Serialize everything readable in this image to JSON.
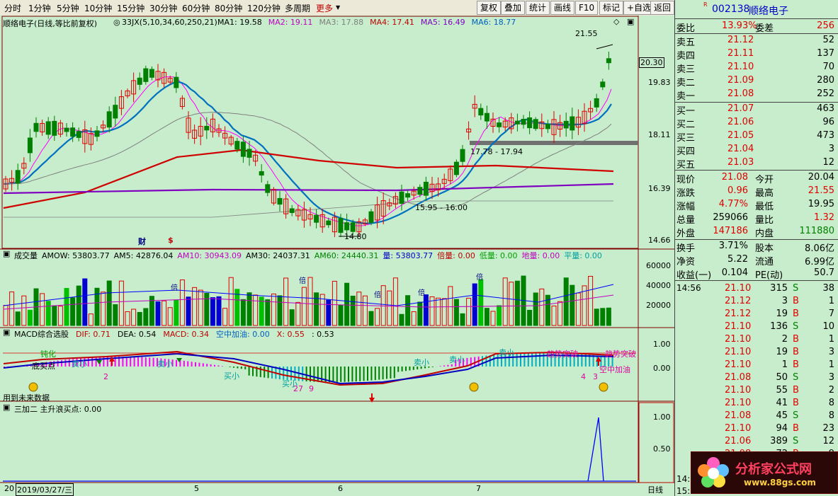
{
  "toolbar": {
    "periods": [
      "分时",
      "1分钟",
      "5分钟",
      "10分钟",
      "15分钟",
      "30分钟",
      "60分钟",
      "80分钟",
      "120分钟",
      "多周期"
    ],
    "more": "更多",
    "buttons": [
      "复权",
      "叠加",
      "统计",
      "画线",
      "F10",
      "标记",
      "+自选",
      "返回"
    ]
  },
  "price_panel": {
    "title": "顺络电子(日线,等比前复权)",
    "indicator": "33JX(5,10,34,60,250,21)",
    "ma": [
      {
        "label": "MA1: 19.58",
        "color": "#000000"
      },
      {
        "label": "MA2: 19.11",
        "color": "#c000c0"
      },
      {
        "label": "MA3: 17.88",
        "color": "#808080"
      },
      {
        "label": "MA4: 17.41",
        "color": "#c00000"
      },
      {
        "label": "MA5: 16.49",
        "color": "#8000c0"
      },
      {
        "label": "MA6: 18.77",
        "color": "#0060c0"
      }
    ],
    "y_ticks": [
      "20.30",
      "19.83",
      "18.11",
      "16.39",
      "14.66"
    ],
    "annotations": {
      "high": "21.55",
      "low": "14.80",
      "zone1": "17.78 - 17.94",
      "zone2": "15.95 - 16.00"
    },
    "markers": [
      "财",
      "$"
    ]
  },
  "volume_panel": {
    "labels": [
      {
        "text": "成交量",
        "color": "#000000"
      },
      {
        "text": "AMOW: 53803.77",
        "color": "#000000"
      },
      {
        "text": "AM5: 42876.04",
        "color": "#000000"
      },
      {
        "text": "AM10: 30943.09",
        "color": "#c000c0"
      },
      {
        "text": "AM30: 24037.31",
        "color": "#000000"
      },
      {
        "text": "AM60: 24440.31",
        "color": "#008000"
      },
      {
        "text": "量: 53803.77",
        "color": "#0000c0"
      },
      {
        "text": "倍量: 0.00",
        "color": "#c00000"
      },
      {
        "text": "低量: 0.00",
        "color": "#00a000"
      },
      {
        "text": "地量: 0.00",
        "color": "#c000c0"
      },
      {
        "text": "平量: 0.00",
        "color": "#00a0a0"
      }
    ],
    "y_ticks": [
      "60000",
      "40000",
      "20000"
    ],
    "markers": [
      "倍",
      "倍",
      "倍",
      "倍",
      "倍"
    ]
  },
  "macd_panel": {
    "labels": [
      {
        "text": "MACD综合选股",
        "color": "#000000"
      },
      {
        "text": "DIF: 0.71",
        "color": "#c00000"
      },
      {
        "text": "DEA: 0.54",
        "color": "#000000"
      },
      {
        "text": "MACD: 0.34",
        "color": "#c00000"
      },
      {
        "text": "空中加油: 0.00",
        "color": "#0060c0"
      },
      {
        "text": "X: 0.55",
        "color": "#c00000"
      },
      {
        "text": ": 0.53",
        "color": "#000000"
      }
    ],
    "y_ticks": [
      "1.00",
      "0.00"
    ],
    "notes": {
      "future": "用到未来数据",
      "t1": "钝化",
      "t2": "底买点",
      "t3": "卖小",
      "t4": "卖小",
      "t5": "买小",
      "t6": "买小",
      "t7": "卖小",
      "t8": "卖小",
      "t9": "趋势突破",
      "t10": "趋势突破",
      "t11": "空中加油",
      "n1": "2",
      "n2": "27",
      "n3": "9",
      "n4": "4",
      "n5": "3"
    }
  },
  "sjr_panel": {
    "label": "三加二 主升浪买点: 0.00",
    "y_ticks": [
      "1.00",
      "0.50"
    ]
  },
  "date_axis": {
    "year": "20",
    "date": "2019/03/27/三",
    "months": [
      "5",
      "6",
      "7"
    ],
    "period": "日线"
  },
  "quote": {
    "code": "002138",
    "name": "顺络电子",
    "weibi": {
      "label": "委比",
      "value": "13.93%",
      "label2": "委差",
      "value2": "256"
    },
    "sell": [
      {
        "label": "卖五",
        "price": "21.12",
        "vol": "52"
      },
      {
        "label": "卖四",
        "price": "21.11",
        "vol": "137"
      },
      {
        "label": "卖三",
        "price": "21.10",
        "vol": "70"
      },
      {
        "label": "卖二",
        "price": "21.09",
        "vol": "280"
      },
      {
        "label": "卖一",
        "price": "21.08",
        "vol": "252"
      }
    ],
    "buy": [
      {
        "label": "买一",
        "price": "21.07",
        "vol": "463"
      },
      {
        "label": "买二",
        "price": "21.06",
        "vol": "96"
      },
      {
        "label": "买三",
        "price": "21.05",
        "vol": "473"
      },
      {
        "label": "买四",
        "price": "21.04",
        "vol": "3"
      },
      {
        "label": "买五",
        "price": "21.03",
        "vol": "12"
      }
    ],
    "stats": [
      {
        "l1": "现价",
        "v1": "21.08",
        "c1": "red",
        "l2": "今开",
        "v2": "20.04",
        "c2": "black"
      },
      {
        "l1": "涨跌",
        "v1": "0.96",
        "c1": "red",
        "l2": "最高",
        "v2": "21.55",
        "c2": "red"
      },
      {
        "l1": "涨幅",
        "v1": "4.77%",
        "c1": "red",
        "l2": "最低",
        "v2": "19.95",
        "c2": "black"
      },
      {
        "l1": "总量",
        "v1": "259066",
        "c1": "black",
        "l2": "量比",
        "v2": "1.32",
        "c2": "red"
      },
      {
        "l1": "外盘",
        "v1": "147186",
        "c1": "red",
        "l2": "内盘",
        "v2": "111880",
        "c2": "green"
      }
    ],
    "stats2": [
      {
        "l1": "换手",
        "v1": "3.71%",
        "l2": "股本",
        "v2": "8.06亿"
      },
      {
        "l1": "净资",
        "v1": "5.22",
        "l2": "流通",
        "v2": "6.99亿"
      },
      {
        "l1": "收益(一)",
        "v1": "0.104",
        "l2": "PE(动)",
        "v2": "50.7"
      }
    ],
    "trades": [
      {
        "time": "14:56",
        "price": "21.10",
        "vol": "315",
        "side": "S",
        "n": "38"
      },
      {
        "time": "",
        "price": "21.12",
        "vol": "3",
        "side": "B",
        "n": "1"
      },
      {
        "time": "",
        "price": "21.12",
        "vol": "19",
        "side": "B",
        "n": "7"
      },
      {
        "time": "",
        "price": "21.10",
        "vol": "136",
        "side": "S",
        "n": "10"
      },
      {
        "time": "",
        "price": "21.10",
        "vol": "2",
        "side": "B",
        "n": "1"
      },
      {
        "time": "",
        "price": "21.10",
        "vol": "19",
        "side": "B",
        "n": "3"
      },
      {
        "time": "",
        "price": "21.10",
        "vol": "1",
        "side": "B",
        "n": "1"
      },
      {
        "time": "",
        "price": "21.08",
        "vol": "50",
        "side": "S",
        "n": "3"
      },
      {
        "time": "",
        "price": "21.10",
        "vol": "55",
        "side": "B",
        "n": "2"
      },
      {
        "time": "",
        "price": "21.10",
        "vol": "41",
        "side": "B",
        "n": "8"
      },
      {
        "time": "",
        "price": "21.08",
        "vol": "45",
        "side": "S",
        "n": "8"
      },
      {
        "time": "",
        "price": "21.10",
        "vol": "94",
        "side": "B",
        "n": "23"
      },
      {
        "time": "",
        "price": "21.06",
        "vol": "389",
        "side": "S",
        "n": "12"
      },
      {
        "time": "",
        "price": "21.08",
        "vol": "72",
        "side": "B",
        "n": "9"
      }
    ],
    "bottom_time": "14:5",
    "bottom_time2": "15:00"
  },
  "watermark": {
    "text": "分析家公式网",
    "url": "www.88gs.com"
  },
  "colors": {
    "bg": "#c7edcc",
    "up": "#e00000",
    "down": "#008000",
    "bid_price": "#e00000"
  }
}
